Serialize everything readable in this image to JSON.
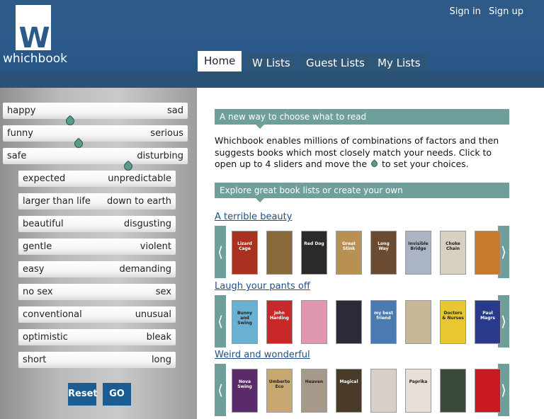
{
  "brand": {
    "name": "whichbook",
    "mark": "W"
  },
  "auth": {
    "sign_in": "Sign in",
    "sign_up": "Sign up"
  },
  "nav": {
    "tabs": [
      {
        "label": "Home",
        "active": true
      },
      {
        "label": "W Lists"
      },
      {
        "label": "Guest Lists"
      },
      {
        "label": "My Lists"
      }
    ]
  },
  "sliders": {
    "main": [
      {
        "left": "happy",
        "right": "sad",
        "value": 0.36
      },
      {
        "left": "funny",
        "right": "serious",
        "value": 0.41
      },
      {
        "left": "safe",
        "right": "disturbing",
        "value": 0.68
      }
    ],
    "more": [
      {
        "left": "expected",
        "right": "unpredictable"
      },
      {
        "left": "larger than life",
        "right": "down to earth"
      },
      {
        "left": "beautiful",
        "right": "disgusting"
      },
      {
        "left": "gentle",
        "right": "violent"
      },
      {
        "left": "easy",
        "right": "demanding"
      },
      {
        "left": "no sex",
        "right": "sex"
      },
      {
        "left": "conventional",
        "right": "unusual"
      },
      {
        "left": "optimistic",
        "right": "bleak"
      },
      {
        "left": "short",
        "right": "long"
      }
    ],
    "reset_label": "Reset",
    "go_label": "GO"
  },
  "main": {
    "band1": "A new way to choose what to read",
    "intro_before": "Whichbook enables millions of combinations of factors and then suggests books which most closely match your needs. Click to open up to 4 sliders and move the",
    "intro_after": "to set your choices.",
    "band2": "Explore great book lists or create your own",
    "lists": [
      {
        "title": "A terrible beauty",
        "covers": [
          {
            "color": "#a8321f",
            "text": "Lizard Cage"
          },
          {
            "color": "#8a6a3a",
            "text": ""
          },
          {
            "color": "#2a2a2a",
            "text": "Red Dog"
          },
          {
            "color": "#b89052",
            "text": "Great Stink"
          },
          {
            "color": "#6a4a30",
            "text": "Long Way"
          },
          {
            "color": "#aab4c4",
            "text": "Invisible Bridge"
          },
          {
            "color": "#d8d0c0",
            "text": "Choke Chain"
          },
          {
            "color": "#c87a2a",
            "text": ""
          }
        ]
      },
      {
        "title": "Laugh your pants off",
        "covers": [
          {
            "color": "#6ab0d0",
            "text": "Bunny and Swing"
          },
          {
            "color": "#c8282a",
            "text": "John Harding"
          },
          {
            "color": "#e098b0",
            "text": ""
          },
          {
            "color": "#2a2a3a",
            "text": ""
          },
          {
            "color": "#4a7ab0",
            "text": "my best friend"
          },
          {
            "color": "#c8b89a",
            "text": ""
          },
          {
            "color": "#e8c830",
            "text": "Doctors & Nurses"
          },
          {
            "color": "#2a3a8a",
            "text": "Paul Magrs"
          }
        ]
      },
      {
        "title": "Weird and wonderful",
        "covers": [
          {
            "color": "#5a2a6a",
            "text": "Nova Swing"
          },
          {
            "color": "#c8a870",
            "text": "Umberto Eco"
          },
          {
            "color": "#a89a8a",
            "text": "Heaven"
          },
          {
            "color": "#4a3a2a",
            "text": "Magical"
          },
          {
            "color": "#d8d0c8",
            "text": ""
          },
          {
            "color": "#e8e0d8",
            "text": "Paprika"
          },
          {
            "color": "#3a4a3a",
            "text": ""
          },
          {
            "color": "#c81820",
            "text": ""
          }
        ]
      }
    ]
  },
  "colors": {
    "header": "#2b5a8a",
    "accent": "#6e9f9b",
    "button": "#1b5c92",
    "link": "#1f4f86"
  }
}
